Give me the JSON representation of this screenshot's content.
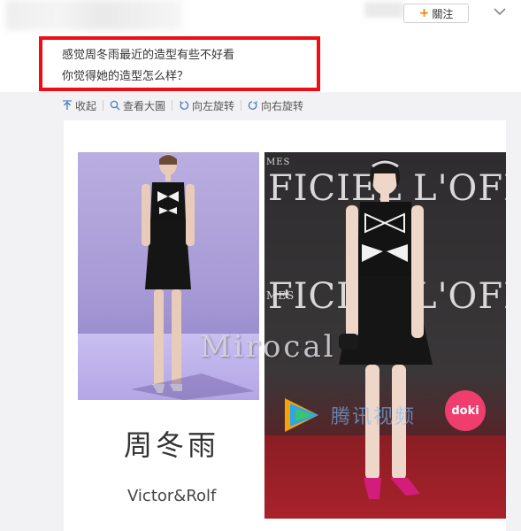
{
  "header": {
    "follow_label": "關注"
  },
  "post": {
    "line1": "感觉周冬雨最近的造型有些不好看",
    "line2": "你觉得她的造型怎么样？"
  },
  "actions": [
    {
      "label": "收起",
      "icon": "collapse-icon"
    },
    {
      "label": "查看大圖",
      "icon": "search-icon"
    },
    {
      "label": "向左旋转",
      "icon": "rotate-left-icon"
    },
    {
      "label": "向右旋转",
      "icon": "rotate-right-icon"
    }
  ],
  "image": {
    "watermark": "Mirocal",
    "name_cn": "周冬雨",
    "brand": "Victor&Rolf",
    "wall_text_top": "FICIEL",
    "wall_text_top_right": "L'OFFIC",
    "wall_text_mid": "FICIEL",
    "wall_text_mid_right": "L'OFFIC",
    "wall_text_small_left": "MES",
    "wall_text_small_mid": "MES",
    "tencent_text": "腾讯视频",
    "doki_label": "doki"
  },
  "colors": {
    "highlight": "#f10d14",
    "accent_plus": "#ff8200",
    "doki": "#ef3e6e"
  }
}
